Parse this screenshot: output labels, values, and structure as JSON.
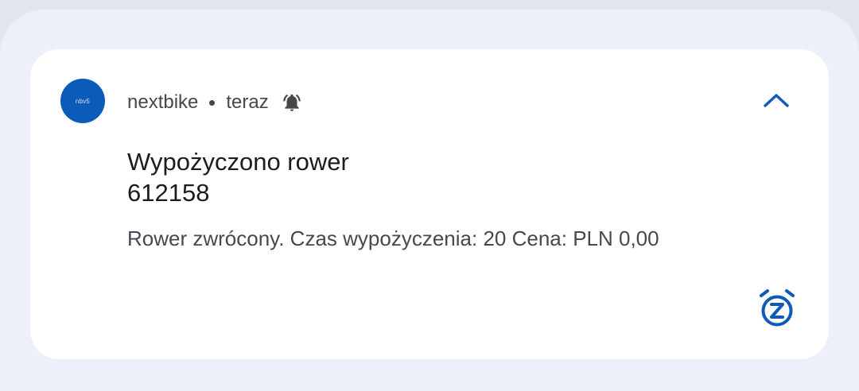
{
  "notification": {
    "app_icon": {
      "text": "nbv5",
      "icon": "nextbike-app-icon",
      "color": "#0b5bb8"
    },
    "app_name": "nextbike",
    "time": "teraz",
    "alert_icon": "bell-icon",
    "expand_icon": "chevron-up-icon",
    "title_line1": "Wypożyczono rower",
    "title_line2": "612158",
    "body": "Rower zwrócony. Czas wypożyczenia: 20 Cena: PLN 0,00",
    "snooze_icon": "snooze-alarm-icon"
  },
  "colors": {
    "accent": "#0b5bb8",
    "card": "#ffffff",
    "shade": "#edeffa",
    "title": "#1b1c20",
    "secondary": "#46484f"
  }
}
